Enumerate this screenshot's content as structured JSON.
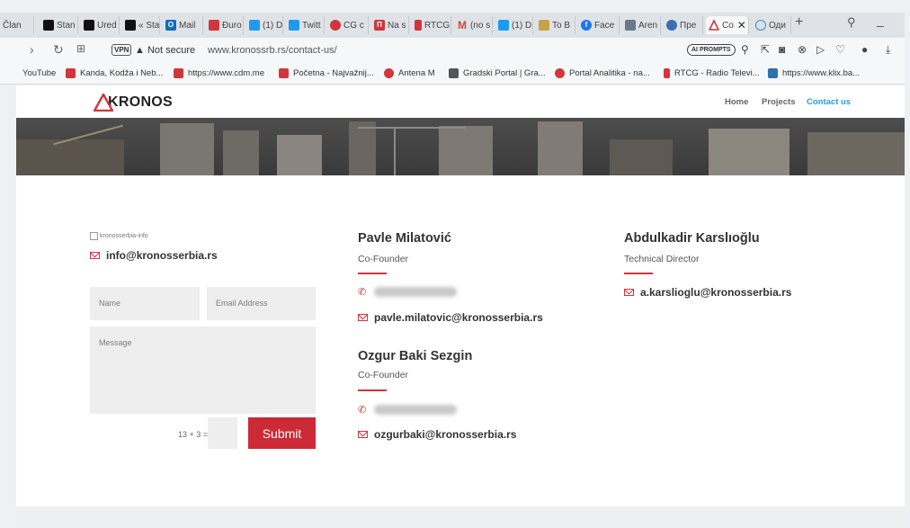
{
  "browser": {
    "tabs": [
      {
        "label": "Član",
        "color": "#9aa0a6"
      },
      {
        "label": "Stan",
        "color": "#111111"
      },
      {
        "label": "Ured",
        "color": "#111111"
      },
      {
        "label": "« Sta",
        "color": "#111111"
      },
      {
        "label": "Mail",
        "color": "#0f6cbd"
      },
      {
        "label": "Đuro",
        "color": "#d0363c"
      },
      {
        "label": "(1) D",
        "color": "#1d9bf0"
      },
      {
        "label": "Twitt",
        "color": "#1d9bf0"
      },
      {
        "label": "CG c",
        "color": "#d0363c"
      },
      {
        "label": "Na s",
        "color": "#d0363c"
      },
      {
        "label": "RTCG",
        "color": "#d0363c"
      },
      {
        "label": "(no s",
        "color": "#d44638"
      },
      {
        "label": "(1) D",
        "color": "#1d9bf0"
      },
      {
        "label": "To B",
        "color": "#c8a24a"
      },
      {
        "label": "Face",
        "color": "#1877f2"
      },
      {
        "label": "Aren",
        "color": "#6a7a8a"
      },
      {
        "label": "Пре",
        "color": "#3a6fb0"
      },
      {
        "label": "Co",
        "color": "#d0363c"
      },
      {
        "label": "Оди",
        "color": "#3a8fd0"
      }
    ],
    "address": {
      "vpn_label": "VPN",
      "security_text": "Not secure",
      "url": "www.kronossrb.rs/contact-us/",
      "ai_prompts_label": "AI PROMPTS"
    },
    "bookmarks": [
      {
        "label": "YouTube",
        "color": ""
      },
      {
        "label": "Kanda, Kodža i Neb...",
        "color": "#d0363c"
      },
      {
        "label": "https://www.cdm.me",
        "color": "#d0363c"
      },
      {
        "label": "Početna - Najvažnij...",
        "color": "#d0363c"
      },
      {
        "label": "Antena M",
        "color": "#d0363c"
      },
      {
        "label": "Gradski Portal | Gra...",
        "color": "#555555"
      },
      {
        "label": "Portal Analitika - na...",
        "color": "#d0363c"
      },
      {
        "label": "RTCG - Radio Televi...",
        "color": "#d0363c"
      },
      {
        "label": "https://www.klix.ba...",
        "color": "#2d6fb0"
      }
    ]
  },
  "site": {
    "logo_text": "KRONOS",
    "nav": [
      {
        "label": "Home"
      },
      {
        "label": "Projects"
      },
      {
        "label": "Contact us"
      }
    ],
    "contact": {
      "broken_image_alt": "kronosserbia-info",
      "info_email": "info@kronosserbia.rs",
      "form": {
        "name_placeholder": "Name",
        "email_placeholder": "Email Address",
        "message_placeholder": "Message",
        "captcha_question": "13 + 3 =",
        "submit_label": "Submit"
      }
    },
    "people": [
      {
        "name": "Pavle Milatović",
        "role": "Co-Founder",
        "email": "pavle.milatovic@kronosserbia.rs"
      },
      {
        "name": "Ozgur Baki Sezgin",
        "role": "Co-Founder",
        "email": "ozgurbaki@kronosserbia.rs"
      },
      {
        "name": "Abdulkadir Karslıoğlu",
        "role": "Technical Director",
        "email": "a.karslioglu@kronosserbia.rs"
      }
    ],
    "accent_color": "#d0363c",
    "nav_active_color": "#2d9bd4"
  }
}
